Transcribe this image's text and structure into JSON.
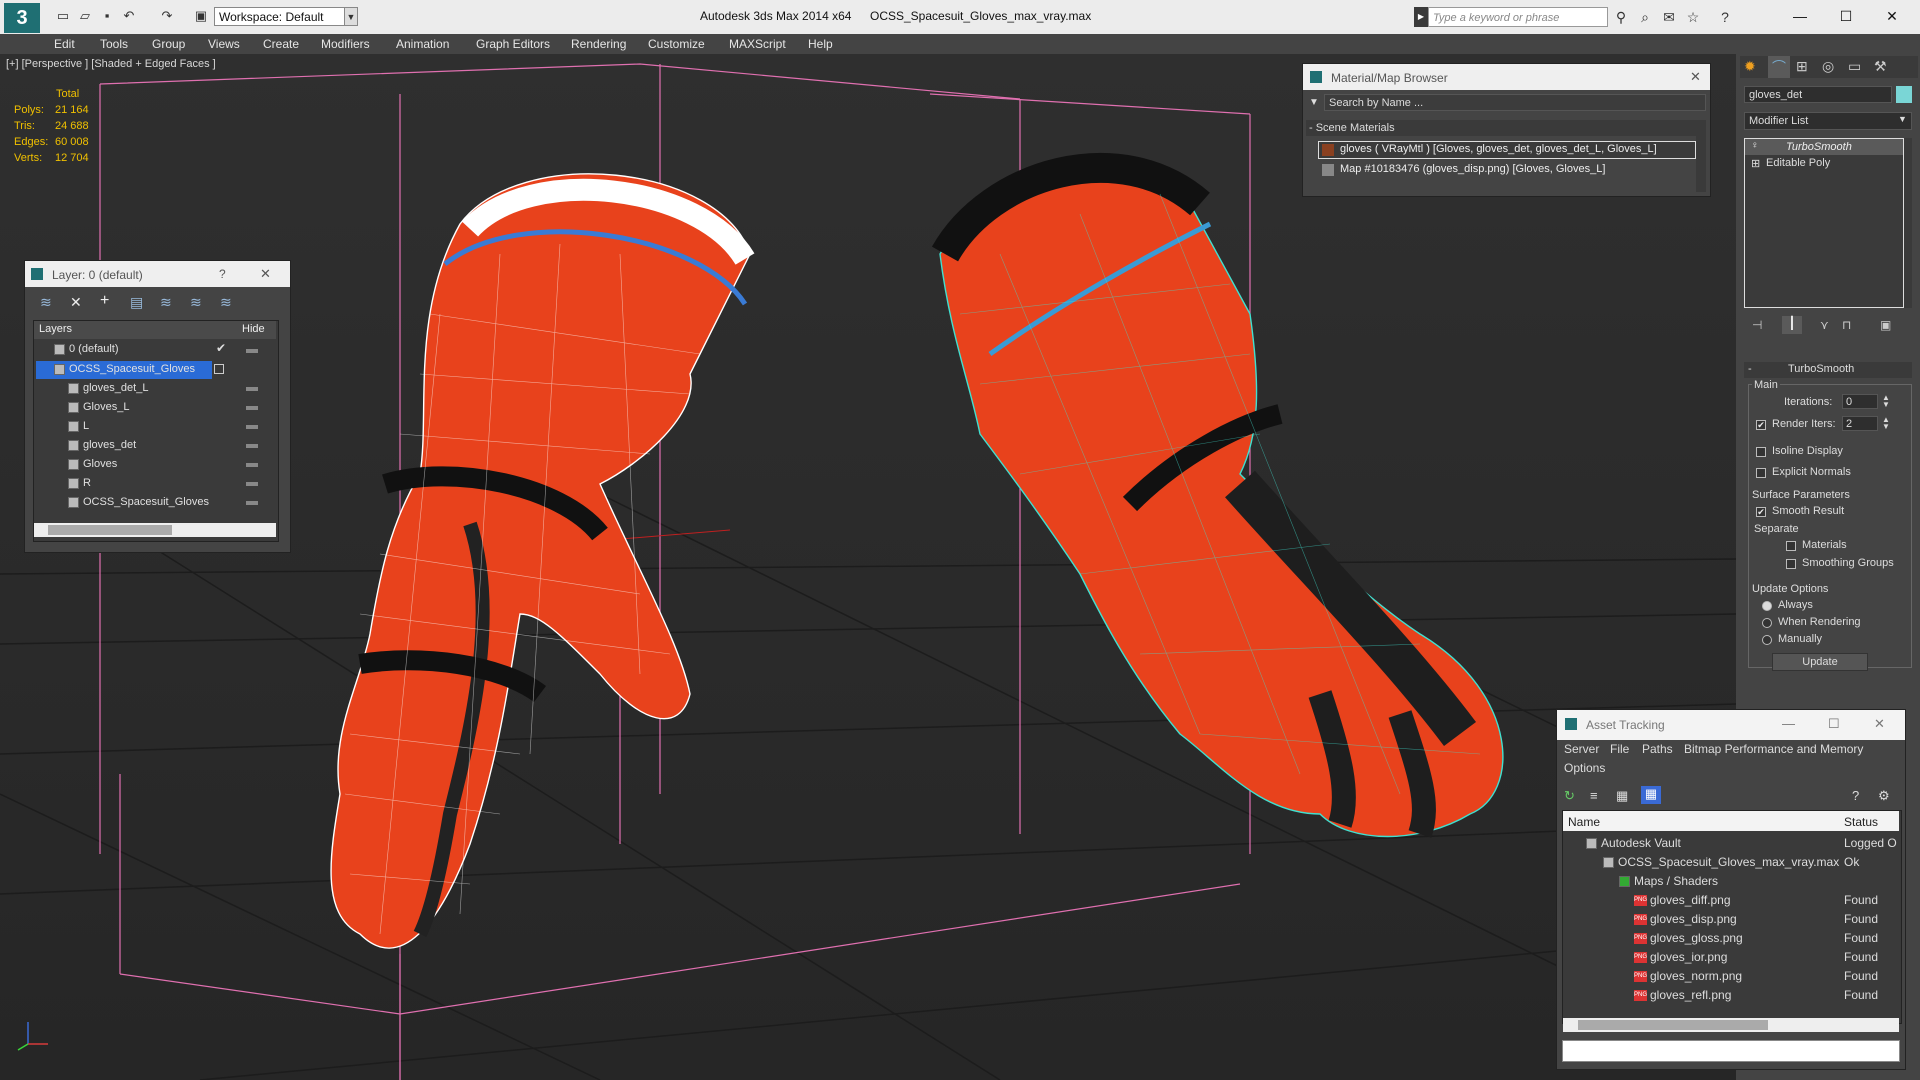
{
  "titlebar": {
    "logo": "3",
    "workspace": "Workspace: Default",
    "app_title": "Autodesk 3ds Max  2014 x64",
    "file_title": "OCSS_Spacesuit_Gloves_max_vray.max",
    "search_placeholder": "Type a keyword or phrase",
    "minimize": "—",
    "maximize": "☐",
    "close": "✕"
  },
  "menu": [
    "Edit",
    "Tools",
    "Group",
    "Views",
    "Create",
    "Modifiers",
    "Animation",
    "Graph Editors",
    "Rendering",
    "Customize",
    "MAXScript",
    "Help"
  ],
  "viewport": {
    "label": "[+] [Perspective ] [Shaded + Edged Faces ]",
    "stats": {
      "total": "Total",
      "rows": [
        {
          "label": "Polys:",
          "value": "21 164"
        },
        {
          "label": "Tris:",
          "value": "24 688"
        },
        {
          "label": "Edges:",
          "value": "60 008"
        },
        {
          "label": "Verts:",
          "value": "12 704"
        }
      ]
    },
    "colors": {
      "glove": "#e8421c",
      "wire_selected": "#ffffff",
      "wire": "#40e0d0",
      "box": "#e070b0"
    }
  },
  "layer_panel": {
    "title": "Layer: 0 (default)",
    "help": "?",
    "close": "✕",
    "col_layers": "Layers",
    "col_hide": "Hide",
    "items": [
      {
        "label": "0 (default)"
      },
      {
        "label": "OCSS_Spacesuit_Gloves"
      },
      {
        "label": "gloves_det_L"
      },
      {
        "label": "Gloves_L"
      },
      {
        "label": "L"
      },
      {
        "label": "gloves_det"
      },
      {
        "label": "Gloves"
      },
      {
        "label": "R"
      },
      {
        "label": "OCSS_Spacesuit_Gloves"
      }
    ]
  },
  "material_browser": {
    "title": "Material/Map Browser",
    "close": "✕",
    "search": "Search by Name ...",
    "section": "- Scene Materials",
    "items": [
      {
        "label": "gloves  ( VRayMtl ) [Gloves, gloves_det, gloves_det_L, Gloves_L]"
      },
      {
        "label": "Map #10183476 (gloves_disp.png) [Gloves, Gloves_L]"
      }
    ]
  },
  "command_panel": {
    "object_name": "gloves_det",
    "modifier_list": "Modifier List",
    "stack": [
      "TurboSmooth",
      "Editable Poly"
    ],
    "rollout_title": "TurboSmooth",
    "main_label": "Main",
    "iterations_label": "Iterations:",
    "iterations_value": "0",
    "render_iters_label": "Render Iters:",
    "render_iters_value": "2",
    "isoline": "Isoline Display",
    "explicit": "Explicit Normals",
    "surface_label": "Surface Parameters",
    "smooth_result": "Smooth Result",
    "separate": "Separate",
    "materials": "Materials",
    "smoothing_groups": "Smoothing Groups",
    "update_options": "Update Options",
    "always": "Always",
    "when_rendering": "When Rendering",
    "manually": "Manually",
    "update_button": "Update"
  },
  "asset_tracking": {
    "title": "Asset Tracking",
    "menu": [
      "Server",
      "File",
      "Paths",
      "Bitmap Performance and Memory",
      "Options"
    ],
    "col_name": "Name",
    "col_status": "Status",
    "rows": [
      {
        "name": "Autodesk Vault",
        "status": "Logged O"
      },
      {
        "name": "OCSS_Spacesuit_Gloves_max_vray.max",
        "status": "Ok"
      },
      {
        "name": "Maps / Shaders",
        "status": ""
      },
      {
        "name": "gloves_diff.png",
        "status": "Found"
      },
      {
        "name": "gloves_disp.png",
        "status": "Found"
      },
      {
        "name": "gloves_gloss.png",
        "status": "Found"
      },
      {
        "name": "gloves_ior.png",
        "status": "Found"
      },
      {
        "name": "gloves_norm.png",
        "status": "Found"
      },
      {
        "name": "gloves_refl.png",
        "status": "Found"
      }
    ]
  }
}
